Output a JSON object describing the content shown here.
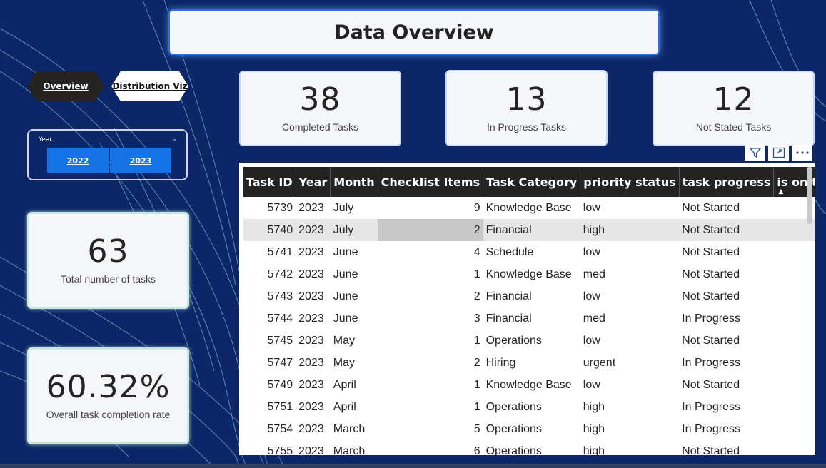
{
  "header": {
    "title": "Data Overview"
  },
  "nav": {
    "overview": "Overview",
    "distribution": "Distribution Viz"
  },
  "slicer": {
    "label": "Year",
    "options": [
      "2022",
      "2023"
    ]
  },
  "kpis": {
    "completed": {
      "value": "38",
      "label": "Completed Tasks"
    },
    "in_progress": {
      "value": "13",
      "label": "In Progress Tasks"
    },
    "not_started": {
      "value": "12",
      "label": "Not Stated Tasks"
    },
    "total": {
      "value": "63",
      "label": "Total number of tasks"
    },
    "completion_rate": {
      "value": "60.32%",
      "label": "Overall task completion rate"
    }
  },
  "table": {
    "columns": [
      "Task ID",
      "Year",
      "Month",
      "Checklist Items",
      "Task Category",
      "priority status",
      "task progress",
      "is on time"
    ],
    "rows": [
      [
        "5739",
        "2023",
        "July",
        "9",
        "Knowledge Base",
        "low",
        "Not Started",
        ""
      ],
      [
        "5740",
        "2023",
        "July",
        "2",
        "Financial",
        "high",
        "Not Started",
        ""
      ],
      [
        "5741",
        "2023",
        "June",
        "4",
        "Schedule",
        "low",
        "Not Started",
        ""
      ],
      [
        "5742",
        "2023",
        "June",
        "1",
        "Knowledge Base",
        "med",
        "Not Started",
        ""
      ],
      [
        "5743",
        "2023",
        "June",
        "2",
        "Financial",
        "low",
        "Not Started",
        ""
      ],
      [
        "5744",
        "2023",
        "June",
        "3",
        "Financial",
        "med",
        "In Progress",
        ""
      ],
      [
        "5745",
        "2023",
        "May",
        "1",
        "Operations",
        "low",
        "Not Started",
        ""
      ],
      [
        "5747",
        "2023",
        "May",
        "2",
        "Hiring",
        "urgent",
        "In Progress",
        ""
      ],
      [
        "5749",
        "2023",
        "April",
        "1",
        "Knowledge Base",
        "low",
        "Not Started",
        ""
      ],
      [
        "5751",
        "2023",
        "April",
        "1",
        "Operations",
        "high",
        "In Progress",
        ""
      ],
      [
        "5754",
        "2023",
        "March",
        "5",
        "Operations",
        "high",
        "In Progress",
        ""
      ],
      [
        "5755",
        "2023",
        "March",
        "6",
        "Operations",
        "high",
        "Not Started",
        ""
      ]
    ]
  },
  "icons": {
    "filter": "filter-icon",
    "focus": "focus-mode-icon",
    "more": "more-options-icon"
  }
}
